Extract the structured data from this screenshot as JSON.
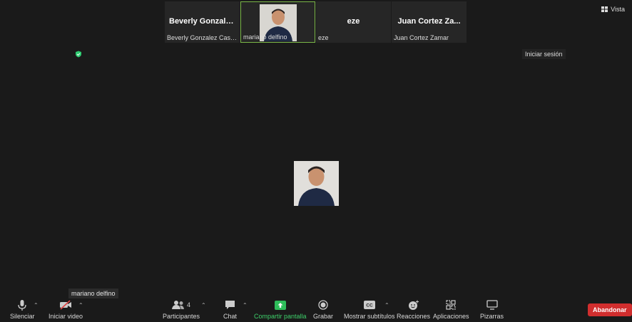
{
  "participants_strip": [
    {
      "display_name": "Beverly  Gonzale...",
      "name_label": "Beverly Gonzalez Casan..."
    },
    {
      "display_name": "",
      "name_label": "mariano delfino",
      "has_video": true
    },
    {
      "display_name": "eze",
      "name_label": "eze"
    },
    {
      "display_name": "Juan Cortez Za...",
      "name_label": "Juan Cortez Zamar"
    }
  ],
  "view_label": "Vista",
  "sign_in_label": "Iniciar sesión",
  "tooltip_name": "mariano delfino",
  "toolbar": {
    "mute": "Silenciar",
    "start_video": "Iniciar video",
    "participants": "Participantes",
    "participants_count": "4",
    "chat": "Chat",
    "share_screen": "Compartir pantalla",
    "record": "Grabar",
    "captions": "Mostrar subtítulos",
    "reactions": "Reacciones",
    "apps": "Aplicaciones",
    "whiteboards": "Pizarras",
    "leave": "Abandonar"
  },
  "colors": {
    "accent_green": "#3ecf6a",
    "leave_red": "#d12e2e",
    "active_border": "#7ab648"
  }
}
